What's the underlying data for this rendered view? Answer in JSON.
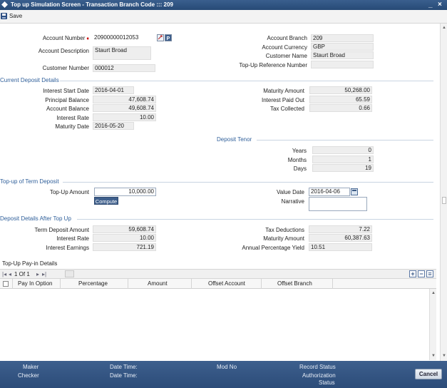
{
  "window": {
    "title": "Top up Simulation Screen - Transaction Branch Code ::: 209",
    "minimize": "_",
    "close": "×"
  },
  "toolbar": {
    "save_label": "Save"
  },
  "account": {
    "account_number_label": "Account Number",
    "account_number": "20900000012053",
    "account_description_label": "Account Description",
    "account_description": "Staurt Broad",
    "customer_number_label": "Customer Number",
    "customer_number": "000012",
    "account_branch_label": "Account Branch",
    "account_branch": "209",
    "account_currency_label": "Account Currency",
    "account_currency": "GBP",
    "customer_name_label": "Customer Name",
    "customer_name": "Staurt Broad",
    "topup_ref_label": "Top-Up Reference Number",
    "topup_ref": ""
  },
  "current_deposit": {
    "section_title": "Current Deposit Details",
    "interest_start_date_label": "Interest Start Date",
    "interest_start_date": "2016-04-01",
    "principal_balance_label": "Principal Balance",
    "principal_balance": "47,608.74",
    "account_balance_label": "Account Balance",
    "account_balance": "49,608.74",
    "interest_rate_label": "Interest Rate",
    "interest_rate": "10.00",
    "maturity_date_label": "Maturity Date",
    "maturity_date": "2016-05-20",
    "maturity_amount_label": "Maturity Amount",
    "maturity_amount": "50,268.00",
    "interest_paid_out_label": "Interest Paid Out",
    "interest_paid_out": "65.59",
    "tax_collected_label": "Tax Collected",
    "tax_collected": "0.66"
  },
  "deposit_tenor": {
    "section_title": "Deposit Tenor",
    "years_label": "Years",
    "years": "0",
    "months_label": "Months",
    "months": "1",
    "days_label": "Days",
    "days": "19"
  },
  "topup": {
    "section_title": "Top-up of Term Deposit",
    "amount_label": "Top-Up Amount",
    "amount": "10,000.00",
    "compute_label": "Compute",
    "value_date_label": "Value Date",
    "value_date": "2016-04-06",
    "narrative_label": "Narrative",
    "narrative": ""
  },
  "after_topup": {
    "section_title": "Deposit Details After Top Up",
    "term_deposit_amount_label": "Term Deposit Amount",
    "term_deposit_amount": "59,608.74",
    "interest_rate_label": "Interest Rate",
    "interest_rate": "10.00",
    "interest_earnings_label": "Interest Earnings",
    "interest_earnings": "721.19",
    "tax_deductions_label": "Tax Deductions",
    "tax_deductions": "7.22",
    "maturity_amount_label": "Maturity Amount",
    "maturity_amount": "60,387.63",
    "apy_label": "Annual Percentage Yield",
    "apy": "10.51"
  },
  "payin": {
    "section_title": "Top-Up Pay-in Details",
    "pager_text": "1 Of 1",
    "columns": [
      "Pay In Option",
      "Percentage",
      "Amount",
      "Offset Account",
      "Offset Branch"
    ]
  },
  "footer": {
    "maker": "Maker",
    "checker": "Checker",
    "date_time_1": "Date Time:",
    "date_time_2": "Date Time:",
    "mod_no": "Mod No",
    "record_status": "Record Status",
    "authorization": "Authorization",
    "status": "Status",
    "cancel_label": "Cancel"
  },
  "colors": {
    "title_bar": "#2f5383",
    "section_text": "#2f5f9a",
    "footer": "#34557f"
  }
}
